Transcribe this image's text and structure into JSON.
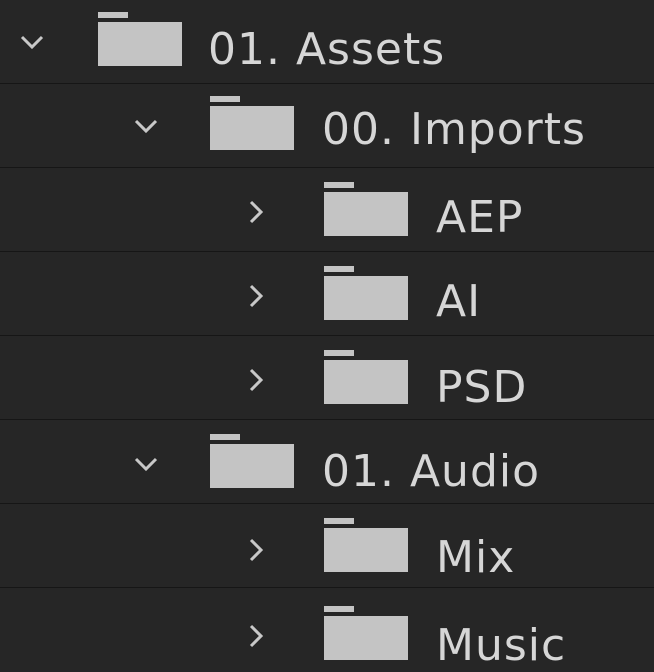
{
  "colors": {
    "background": "#262626",
    "row_divider": "#161616",
    "folder_fill": "#c4c4c4",
    "text": "#d6d6d6"
  },
  "tree": {
    "items": [
      {
        "label": "01. Assets",
        "expanded": true,
        "icon": "folder-icon",
        "chevron": "chevron-down-icon"
      },
      {
        "label": "00. Imports",
        "expanded": true,
        "icon": "folder-icon",
        "chevron": "chevron-down-icon"
      },
      {
        "label": "AEP",
        "expanded": false,
        "icon": "folder-icon",
        "chevron": "chevron-right-icon"
      },
      {
        "label": "AI",
        "expanded": false,
        "icon": "folder-icon",
        "chevron": "chevron-right-icon"
      },
      {
        "label": "PSD",
        "expanded": false,
        "icon": "folder-icon",
        "chevron": "chevron-right-icon"
      },
      {
        "label": "01. Audio",
        "expanded": true,
        "icon": "folder-icon",
        "chevron": "chevron-down-icon"
      },
      {
        "label": "Mix",
        "expanded": false,
        "icon": "folder-icon",
        "chevron": "chevron-right-icon"
      },
      {
        "label": "Music",
        "expanded": false,
        "icon": "folder-icon",
        "chevron": "chevron-right-icon"
      }
    ]
  }
}
